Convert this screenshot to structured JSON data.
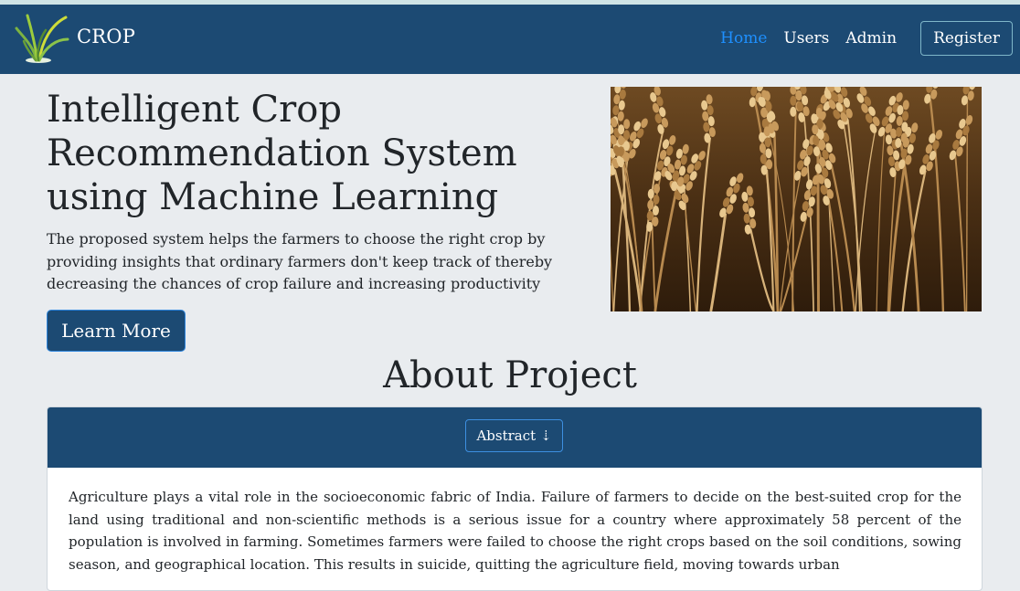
{
  "brand": {
    "name": "CROP",
    "logo_icon": "wheat-plant-icon"
  },
  "nav": {
    "items": [
      {
        "label": "Home",
        "active": true
      },
      {
        "label": "Users",
        "active": false
      },
      {
        "label": "Admin",
        "active": false
      }
    ],
    "register_label": "Register"
  },
  "hero": {
    "title_line1": "Intelligent Crop",
    "title_line2": "Recommendation System",
    "title_line3": "using Machine Learning",
    "description": "The proposed system helps the farmers to choose the right crop by providing insights that ordinary farmers don't keep track of thereby decreasing the chances of crop failure and increasing productivity",
    "cta_label": "Learn More"
  },
  "about": {
    "title": "About Project",
    "abstract_button": "Abstract ⇣",
    "body": "Agriculture plays a vital role in the socioeconomic fabric of India. Failure of farmers to decide on the best-suited crop for the land using traditional and non-scientific methods is a serious issue for a country where approximately 58 percent of the population is involved in farming. Sometimes farmers were failed to choose the right crops based on the soil conditions, sowing season, and geographical location. This results in suicide, quitting the agriculture field, moving towards urban"
  },
  "colors": {
    "navbar": "#1c4a73",
    "active_link": "#1e90ff",
    "page_bg": "#e9ecef"
  }
}
